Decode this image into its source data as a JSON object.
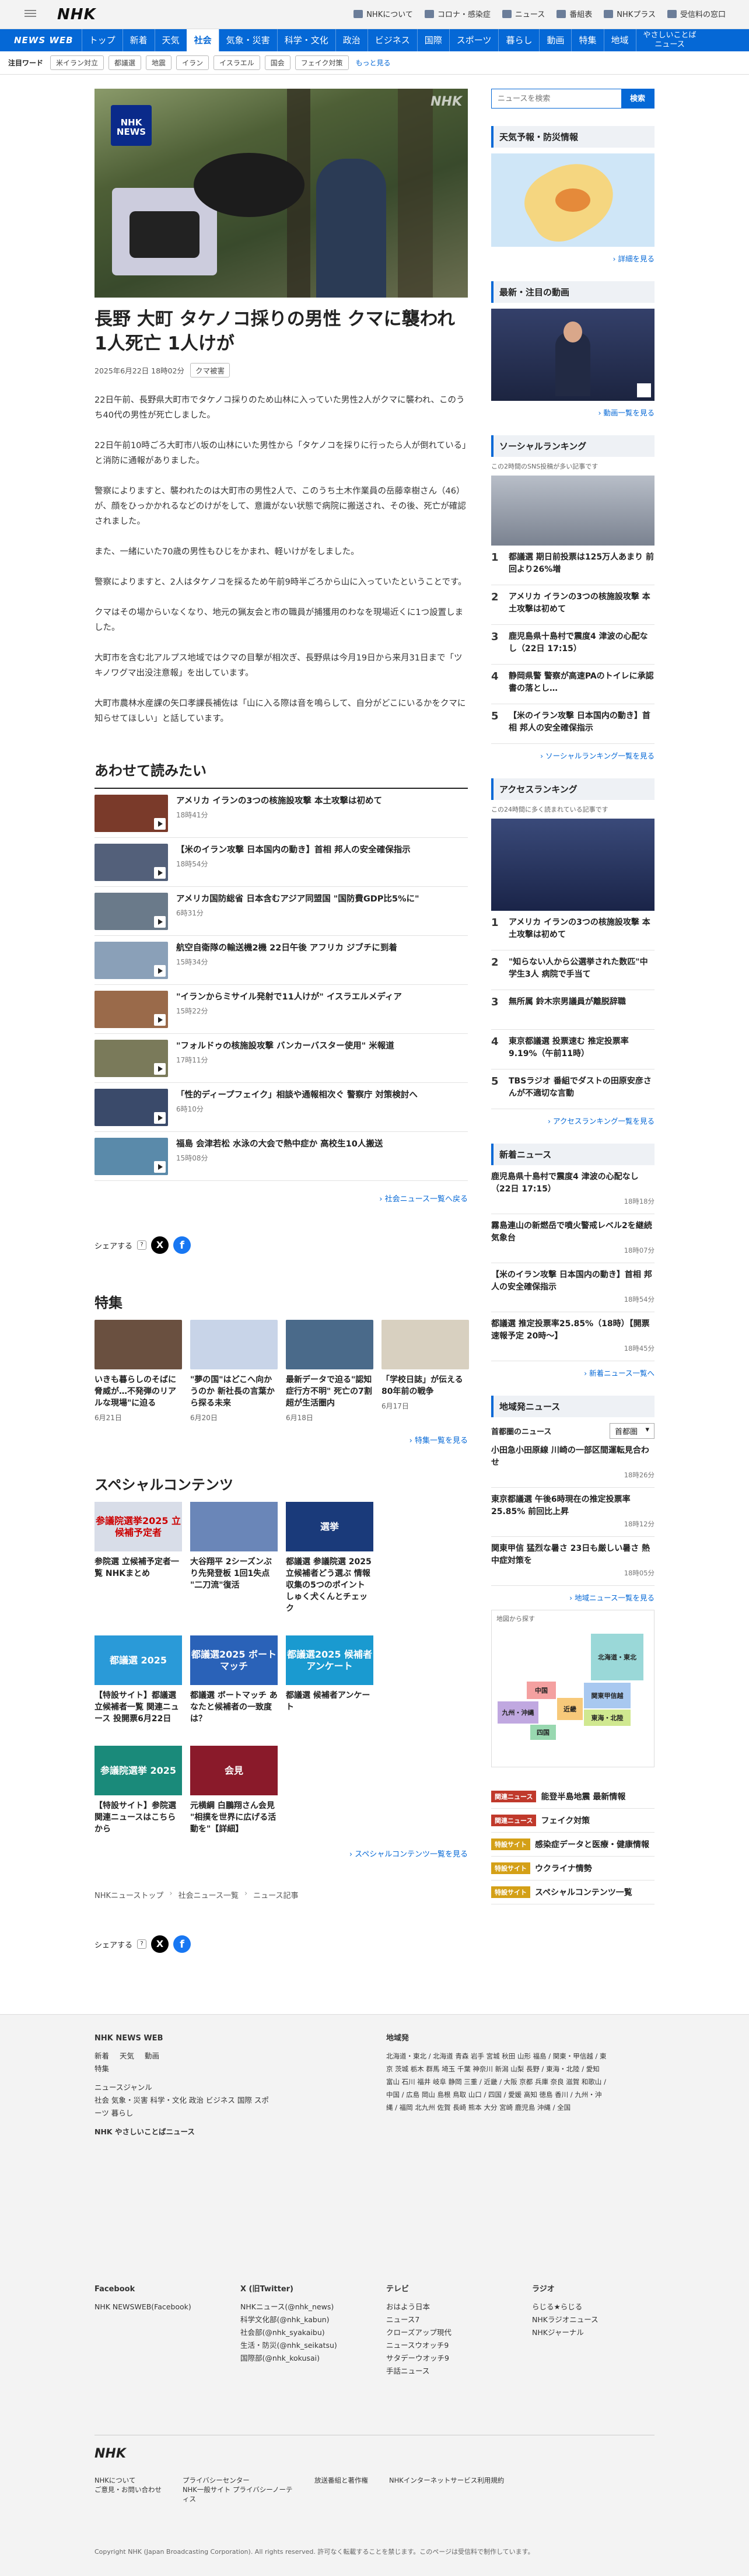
{
  "header": {
    "logo": "NHK",
    "links": [
      "NHKについて",
      "コロナ・感染症",
      "ニュース",
      "番組表",
      "NHKプラス",
      "受信料の窓口"
    ]
  },
  "nav": {
    "brand": "NEWS WEB",
    "items": [
      "トップ",
      "新着",
      "天気",
      "社会",
      "気象・災害",
      "科学・文化",
      "政治",
      "ビジネス",
      "国際",
      "スポーツ",
      "暮らし",
      "動画",
      "特集",
      "地域"
    ],
    "easy": [
      "やさしいことば",
      "ニュース"
    ]
  },
  "keywords": {
    "label": "注目ワード",
    "chips": [
      "米イラン対立",
      "都議選",
      "地震",
      "イラン",
      "イスラエル",
      "国会",
      "フェイク対策"
    ],
    "more": "もっと見る"
  },
  "article": {
    "hero_logo": "NHK NEWS",
    "hero_watermark": "NHK",
    "title": "長野 大町 タケノコ採りの男性 クマに襲われ 1人死亡 1人けが",
    "date": "2025年6月22日 18時02分",
    "tag": "クマ被害",
    "paragraphs": [
      "22日午前、長野県大町市でタケノコ採りのため山林に入っていた男性2人がクマに襲われ、このうち40代の男性が死亡しました。",
      "22日午前10時ごろ大町市八坂の山林にいた男性から「タケノコを採りに行ったら人が倒れている」と消防に通報がありました。",
      "警察によりますと、襲われたのは大町市の男性2人で、このうち土木作業員の岳藤幸樹さん（46）が、顔をひっかかれるなどのけがをして、意識がない状態で病院に搬送され、その後、死亡が確認されました。",
      "また、一緒にいた70歳の男性もひじをかまれ、軽いけがをしました。",
      "警察によりますと、2人はタケノコを採るため午前9時半ごろから山に入っていたということです。",
      "クマはその場からいなくなり、地元の猟友会と市の職員が捕獲用のわなを現場近くに1つ設置しました。",
      "大町市を含む北アルプス地域ではクマの目撃が相次ぎ、長野県は今月19日から来月31日まで「ツキノワグマ出没注意報」を出しています。",
      "大町市農林水産課の矢口孝課長補佐は「山に入る際は音を鳴らして、自分がどこにいるかをクマに知らせてほしい」と話しています。"
    ]
  },
  "related": {
    "heading": "あわせて読みたい",
    "items": [
      {
        "title": "アメリカ イランの3つの核施設攻撃 本土攻撃は初めて",
        "time": "18時41分",
        "color": "#7a3a2a"
      },
      {
        "title": "【米のイラン攻撃 日本国内の動き】首相 邦人の安全確保指示",
        "time": "18時54分",
        "color": "#53607a"
      },
      {
        "title": "アメリカ国防総省 日本含むアジア同盟国 \"国防費GDP比5%に\"",
        "time": "6時31分",
        "color": "#6a7a8a"
      },
      {
        "title": "航空自衛隊の輸送機2機 22日午後 アフリカ ジブチに到着",
        "time": "15時34分",
        "color": "#8aa0b8"
      },
      {
        "title": "\"イランからミサイル発射で11人けが\" イスラエルメディア",
        "time": "15時22分",
        "color": "#9a6a4a"
      },
      {
        "title": "\"フォルドゥの核施設攻撃 バンカーバスター使用\" 米報道",
        "time": "17時11分",
        "color": "#7a7a5a"
      },
      {
        "title": "「性的ディープフェイク」相談や通報相次ぐ 警察庁 対策検討へ",
        "time": "6時10分",
        "color": "#3a4a6a"
      },
      {
        "title": "福島 会津若松 水泳の大会で熱中症か 高校生10人搬送",
        "time": "15時08分",
        "color": "#5a8aaa"
      }
    ],
    "more": "社会ニュース一覧へ戻る"
  },
  "share": {
    "label": "シェアする",
    "help": "?"
  },
  "features": {
    "heading": "特集",
    "items": [
      {
        "title": "いきも暮らしのそばに脅威が…不発弾のリアルな現場\"に迫る",
        "date": "6月21日",
        "color": "#6a5040"
      },
      {
        "title": "\"夢の国\"はどこへ向かうのか 新社長の言葉から探る未来",
        "date": "6月20日",
        "color": "#c8d4e8"
      },
      {
        "title": "最新データで迫る\"認知症行方不明\" 死亡の7割超が生活圏内",
        "date": "6月18日",
        "color": "#4a6a8a"
      },
      {
        "title": "「学校日誌」が伝える80年前の戦争",
        "date": "6月17日",
        "color": "#d8d0c0"
      }
    ],
    "more": "特集一覧を見る"
  },
  "special": {
    "heading": "スペシャルコンテンツ",
    "items": [
      {
        "title": "参院選 立候補予定者一覧 NHKまとめ",
        "label": "参議院選挙2025 立候補予定者",
        "color": "#d8dde8",
        "fg": "#c00"
      },
      {
        "title": "大谷翔平 2シーズンぶり先発登板 1回1失点 \"二刀流\"復活",
        "label": "",
        "color": "#6a86b8",
        "fg": "#fff"
      },
      {
        "title": "都議選 参議院選 2025 立候補者どう選ぶ 情報収集の5つのポイント しゅく犬くんとチェック",
        "label": "選挙",
        "color": "#1a3a7a",
        "fg": "#fff"
      },
      {
        "title": "【特設サイト】都議選 立候補者一覧 関連ニュース 投開票6月22日",
        "label": "都議選 2025",
        "color": "#2a9ad8",
        "fg": "#fff"
      },
      {
        "title": "都議選 ボートマッチ あなたと候補者の一致度は？",
        "label": "都議選2025 ボートマッチ",
        "color": "#2a62b8",
        "fg": "#fff"
      },
      {
        "title": "都議選 候補者アンケート",
        "label": "都議選2025 候補者アンケート",
        "color": "#1a9ad0",
        "fg": "#fff"
      },
      {
        "title": "【特設サイト】参院選 関連ニュースはこちらから",
        "label": "参議院選挙 2025",
        "color": "#1a8a7a",
        "fg": "#fff"
      },
      {
        "title": "元横綱 白鵬翔さん会見 \"相撲を世界に広げる活動を\"【詳細】",
        "label": "会見",
        "color": "#8a1a2a",
        "fg": "#fff"
      }
    ],
    "more": "スペシャルコンテンツ一覧を見る"
  },
  "breadcrumb": [
    "NHKニューストップ",
    "社会ニュース一覧",
    "ニュース記事"
  ],
  "sidebar": {
    "search_placeholder": "ニュースを検索",
    "search_btn": "検索",
    "weather": {
      "heading": "天気予報・防災情報",
      "more": "詳細を見る"
    },
    "video": {
      "heading": "最新・注目の動画",
      "more": "動画一覧を見る"
    },
    "social": {
      "heading": "ソーシャルランキング",
      "sub": "この2時間のSNS投稿が多い記事です",
      "items": [
        "都議選 期日前投票は125万人あまり 前回より26%増",
        "アメリカ イランの3つの核施設攻撃 本土攻撃は初めて",
        "鹿児島県十島村で震度4 津波の心配なし（22日 17:15）",
        "静岡県警 警察が高速PAのトイレに承認書の落とし…",
        "【米のイラン攻撃 日本国内の動き】首相 邦人の安全確保指示"
      ],
      "more": "ソーシャルランキング一覧を見る"
    },
    "access": {
      "heading": "アクセスランキング",
      "sub": "この24時間に多く読まれている記事です",
      "items": [
        "アメリカ イランの3つの核施設攻撃 本土攻撃は初めて",
        "\"知らない人から公選挙された数匹\"中学生3人 病院で手当て",
        "無所属 鈴木宗男議員が離脱辞職",
        "東京都議選 投票速む 推定投票率 9.19%（午前11時）",
        "TBSラジオ 番組でダストの田原安彦さんが不適切な言動"
      ],
      "more": "アクセスランキング一覧を見る"
    },
    "newnews": {
      "heading": "新着ニュース",
      "items": [
        {
          "t": "鹿児島県十島村で震度4 津波の心配なし（22日 17:15）",
          "d": "18時18分"
        },
        {
          "t": "霧島連山の新燃岳で噴火警戒レベル2を継続 気象台",
          "d": "18時07分"
        },
        {
          "t": "【米のイラン攻撃 日本国内の動き】首相 邦人の安全確保指示",
          "d": "18時54分"
        },
        {
          "t": "都議選 推定投票率25.85%（18時）【開票速報予定 20時〜】",
          "d": "18時45分"
        }
      ],
      "more": "新着ニュース一覧へ"
    },
    "local": {
      "heading": "地域発ニュース",
      "label": "首都圏のニュース",
      "select": "首都圏",
      "items": [
        {
          "t": "小田急小田原線 川崎の一部区間運転見合わせ",
          "d": "18時26分"
        },
        {
          "t": "東京都議選 午後6時現在の推定投票率 25.85% 前回比上昇",
          "d": "18時12分"
        },
        {
          "t": "関東甲信 猛烈な暑さ 23日も厳しい暑さ 熱中症対策を",
          "d": "18時05分"
        }
      ],
      "more": "地域ニュース一覧を見る"
    },
    "map": {
      "label": "地図から探す",
      "regions": [
        "北海道・東北",
        "中国",
        "近畿",
        "関東甲信越",
        "東海・北陸",
        "九州・沖縄",
        "四国"
      ]
    },
    "links": [
      {
        "badge": "関連ニュース",
        "text": "能登半島地震 最新情報",
        "color": "#c0392b"
      },
      {
        "badge": "関連ニュース",
        "text": "フェイク対策",
        "color": "#c0392b"
      },
      {
        "badge": "特設サイト",
        "text": "感染症データと医療・健康情報",
        "color": "#d4a017"
      },
      {
        "badge": "特設サイト",
        "text": "ウクライナ情勢",
        "color": "#d4a017"
      },
      {
        "badge": "特設サイト",
        "text": "スペシャルコンテンツ一覧",
        "color": "#d4a017"
      }
    ]
  },
  "footer": {
    "brand": "NHK NEWS WEB",
    "col1": [
      "新着",
      "天気",
      "動画",
      "特集"
    ],
    "col1b": [
      "ニュースジャンル"
    ],
    "genres": "社会 気象・災害 科学・文化 政治 ビジネス 国際 スポーツ 暮らし",
    "easy": "NHK やさしいことばニュース",
    "region_title": "地域発",
    "regions": "北海道・東北 / 北海道 青森 岩手 宮城 秋田 山形 福島 / 関東・甲信越 / 東京 茨城 栃木 群馬 埼玉 千葉 神奈川 新潟 山梨 長野 / 東海・北陸 / 愛知 富山 石川 福井 岐阜 静岡 三重 / 近畿 / 大阪 京都 兵庫 奈良 滋賀 和歌山 / 中国 / 広島 岡山 島根 鳥取 山口 / 四国 / 愛媛 高知 徳島 香川 / 九州・沖縄 / 福岡 北九州 佐賀 長崎 熊本 大分 宮崎 鹿児島 沖縄 / 全国",
    "fb_title": "Facebook",
    "fb": [
      "NHK NEWSWEB(Facebook)"
    ],
    "x_title": "X (旧Twitter)",
    "x": [
      "NHKニュース(@nhk_news)",
      "科学文化部(@nhk_kabun)",
      "社会部(@nhk_syakaibu)",
      "生活・防災(@nhk_seikatsu)",
      "国際部(@nhk_kokusai)"
    ],
    "tv_title": "テレビ",
    "tv": [
      "おはよう日本",
      "ニュース7",
      "クローズアップ現代",
      "ニュースウオッチ9",
      "サタデーウオッチ9",
      "手話ニュース"
    ],
    "radio_title": "ラジオ",
    "radio": [
      "らじる★らじる",
      "NHKラジオニュース",
      "NHKジャーナル"
    ],
    "bottom_links": [
      "NHKについて",
      "ご意見・お問い合わせ",
      "プライバシーセンター",
      "NHK一般サイト プライバシーノーティス",
      "放送番組と著作権",
      "NHKインターネットサービス利用規約"
    ],
    "copyright": "Copyright NHK (Japan Broadcasting Corporation). All rights reserved. 許可なく転載することを禁じます。このページは受信料で制作しています。"
  }
}
